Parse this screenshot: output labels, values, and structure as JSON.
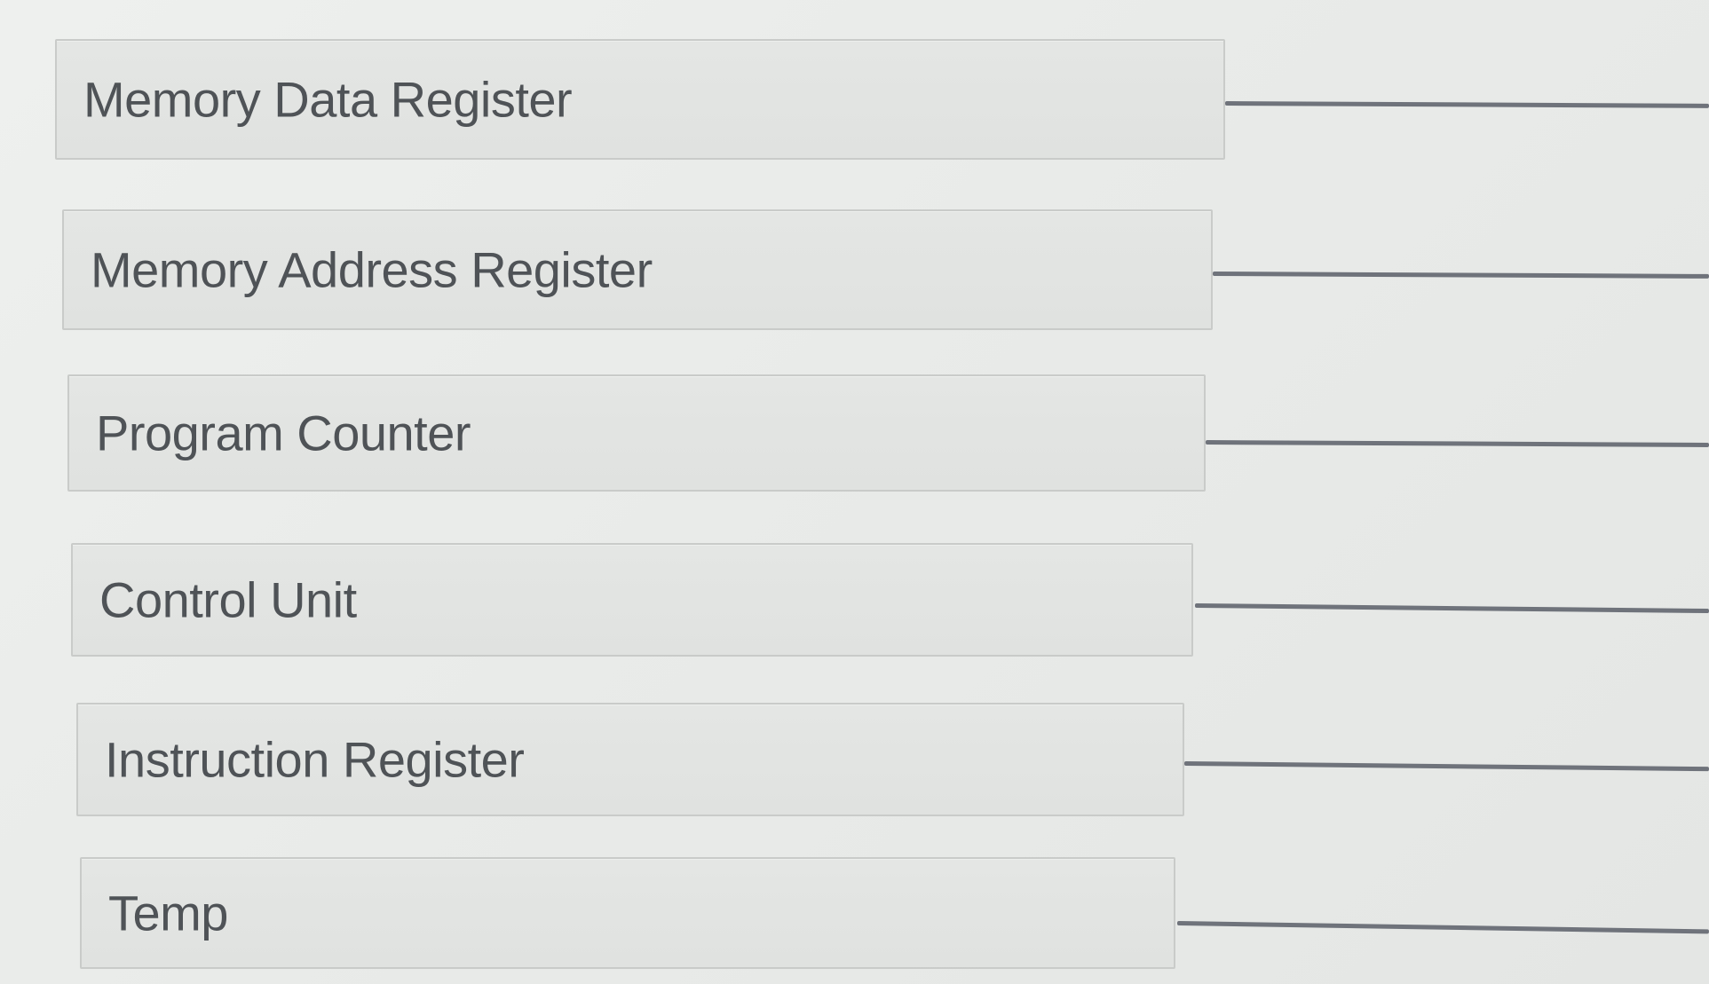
{
  "match_items": [
    {
      "label": "Memory Data Register"
    },
    {
      "label": "Memory Address Register"
    },
    {
      "label": "Program Counter"
    },
    {
      "label": "Control Unit"
    },
    {
      "label": "Instruction Register"
    },
    {
      "label": "Temp"
    }
  ]
}
